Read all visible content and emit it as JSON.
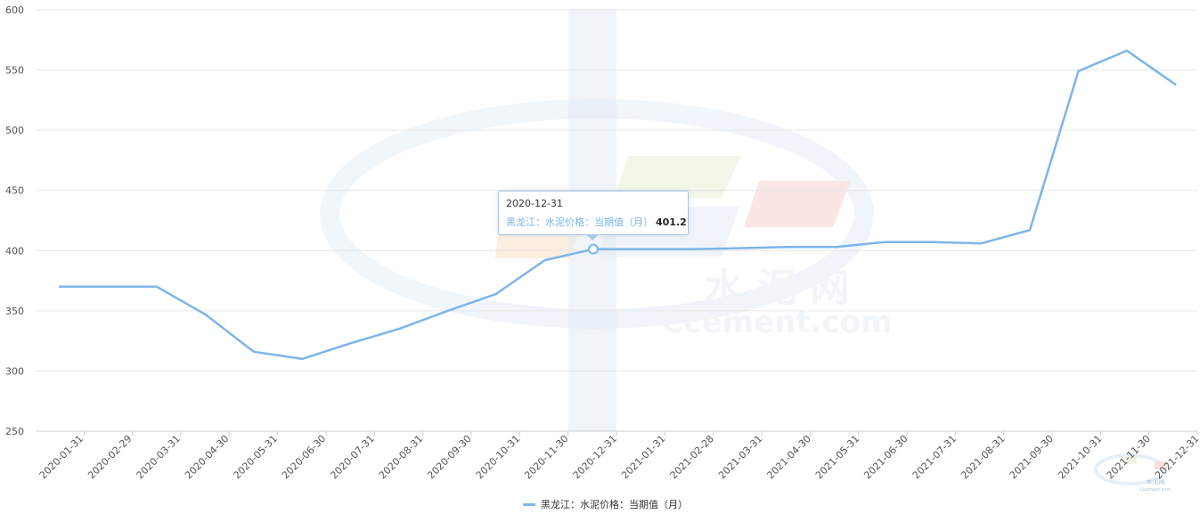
{
  "chart_data": {
    "type": "line",
    "categories": [
      "2020-01-31",
      "2020-02-29",
      "2020-03-31",
      "2020-04-30",
      "2020-05-31",
      "2020-06-30",
      "2020-07-31",
      "2020-08-31",
      "2020-09-30",
      "2020-10-31",
      "2020-11-30",
      "2020-12-31",
      "2021-01-31",
      "2021-02-28",
      "2021-03-31",
      "2021-04-30",
      "2021-05-31",
      "2021-06-30",
      "2021-07-31",
      "2021-08-31",
      "2021-09-30",
      "2021-10-31",
      "2021-11-30",
      "2021-12-31"
    ],
    "series": [
      {
        "name": "黑龙江：水泥价格：当期值（月）",
        "values": [
          370,
          370,
          370,
          347,
          316,
          310,
          323,
          335,
          350,
          364,
          392,
          401.2,
          401.2,
          401.2,
          402,
          403,
          403,
          407,
          407,
          406,
          417,
          549,
          566,
          538
        ]
      }
    ],
    "ylim": [
      250,
      600
    ],
    "yticks": [
      250,
      300,
      350,
      400,
      450,
      500,
      550,
      600
    ],
    "grid": true,
    "legend": "bottom-center",
    "color": "#7cb5ec",
    "highlight_index": 11
  },
  "tooltip": {
    "date": "2020-12-31",
    "label": "黑龙江：水泥价格：当期值（月）",
    "value": "401.2"
  },
  "legend": {
    "label": "黑龙江：水泥价格：当期值（月）"
  },
  "watermark": {
    "title": "水 泥 网",
    "domain": "Ccement.com",
    "small_title": "水泥网",
    "small_domain": "Ccement.com"
  }
}
